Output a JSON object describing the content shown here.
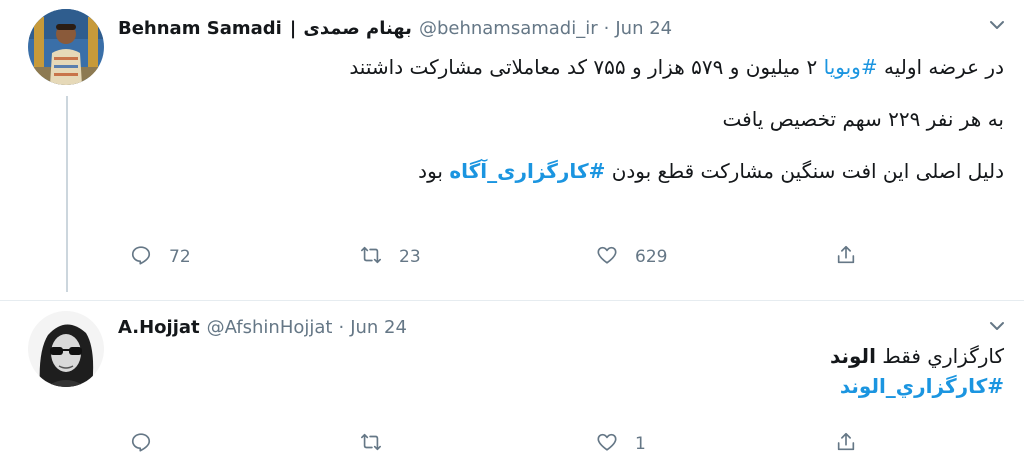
{
  "tweets": [
    {
      "author_name": "Behnam Samadi",
      "author_sep": "|",
      "author_name_fa": "بهنام صمدی",
      "handle": "@behnamsamadi_ir",
      "dot": "·",
      "date": "Jun 24",
      "lines": [
        {
          "before": "در عرضه اولیه ",
          "tag": "#وبویا",
          "after": " ۲ میلیون و ۵۷۹ هزار و ۷۵۵ کد معاملاتی مشارکت داشتند"
        },
        {
          "text": "به هر نفر ۲۲۹ سهم تخصیص یافت"
        },
        {
          "before": "دلیل اصلی این افت سنگین مشارکت قطع بودن ",
          "tag": "#کارگزاری_آگاه",
          "after": " بود"
        }
      ],
      "counts": {
        "reply": "72",
        "retweet": "23",
        "like": "629"
      }
    },
    {
      "author_name": "A.Hojjat",
      "handle": "@AfshinHojjat",
      "dot": "·",
      "date": "Jun 24",
      "lines": [
        {
          "before": "کارگزاري فقط ",
          "bold": "الوند"
        },
        {
          "tag": "#کارگزاري_الوند"
        }
      ],
      "counts": {
        "reply": "",
        "retweet": "",
        "like": "1"
      }
    }
  ],
  "colors": {
    "accent": "#1b95e0",
    "muted": "#657786",
    "text": "#14171a",
    "divider": "#e6ecf0"
  },
  "icons": {
    "reply": "reply-icon",
    "retweet": "retweet-icon",
    "like": "like-icon",
    "share": "share-icon",
    "more": "chevron-down-icon"
  }
}
